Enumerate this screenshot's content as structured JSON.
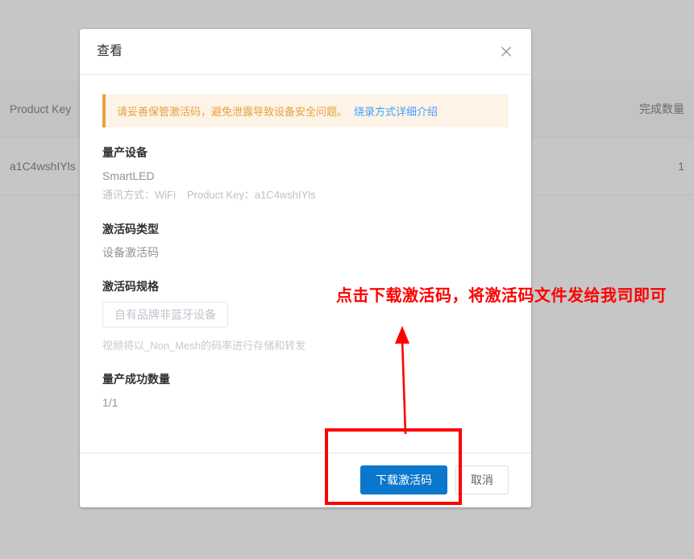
{
  "background": {
    "table": {
      "columns": [
        "Product Key",
        "",
        "完成数量"
      ],
      "rows": [
        {
          "product_key": "a1C4wshIYls",
          "middle": "",
          "completed_count": "1"
        }
      ]
    }
  },
  "dialog": {
    "title": "查看",
    "close_icon": "close-icon",
    "alert": {
      "text": "请妥善保管激活码，避免泄露导致设备安全问题。",
      "link_label": "烧录方式详细介绍",
      "accent_color": "#e6a23c",
      "background_color": "#fdf3e6",
      "link_color": "#409eff"
    },
    "sections": [
      {
        "title": "量产设备",
        "value": "SmartLED",
        "meta_label_1": "通讯方式：",
        "meta_value_1": "WiFi",
        "meta_label_2": "Product Key：",
        "meta_value_2": "a1C4wshIYls"
      },
      {
        "title": "激活码类型",
        "value": "设备激活码"
      },
      {
        "title": "激活码规格",
        "spec_value": "自有品牌非蓝牙设备",
        "hint": "视频将以_Non_Mesh的码率进行存储和转发"
      },
      {
        "title": "量产成功数量",
        "value": "1/1"
      }
    ],
    "footer": {
      "primary_label": "下载激活码",
      "primary_color": "#0a77cc",
      "cancel_label": "取消"
    }
  },
  "annotations": {
    "note_text": "点击下载激活码，将激活码文件发给我司即可",
    "color": "#ff0000",
    "arrow": "up-arrow-annotation",
    "highlight_box": "highlight-rectangle-annotation"
  }
}
